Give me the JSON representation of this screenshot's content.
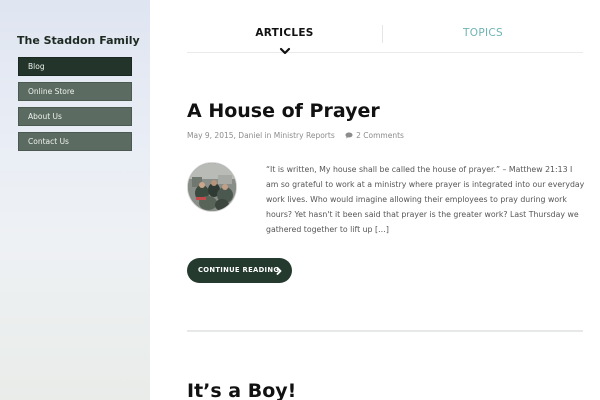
{
  "site": {
    "title": "The Staddon Family"
  },
  "nav": {
    "items": [
      {
        "label": "Blog",
        "active": true
      },
      {
        "label": "Online Store",
        "active": false
      },
      {
        "label": "About Us",
        "active": false
      },
      {
        "label": "Contact Us",
        "active": false
      }
    ]
  },
  "tabs": {
    "articles": "ARTICLES",
    "topics": "TOPICS"
  },
  "posts": [
    {
      "title": "A House of Prayer",
      "date": "May 9, 2015",
      "author_line": ", Daniel in Ministry Reports",
      "comments": "2 Comments",
      "excerpt": "“It is written, My house shall be called the house of prayer.” – Matthew 21:13 I am so grateful to work at a ministry where prayer is integrated into our everyday work lives.  Who would imagine allowing their employees to pray during work hours? Yet hasn't it been said that prayer is the greater work? Last Thursday we gathered together to lift up […]",
      "continue_label": "CONTINUE READING"
    },
    {
      "title": "It’s a Boy!"
    }
  ],
  "colors": {
    "accent_dark": "#243a2f",
    "nav_bg": "#5b6b61",
    "nav_active_bg": "#23352b",
    "topics_link": "#6fb3b3"
  }
}
